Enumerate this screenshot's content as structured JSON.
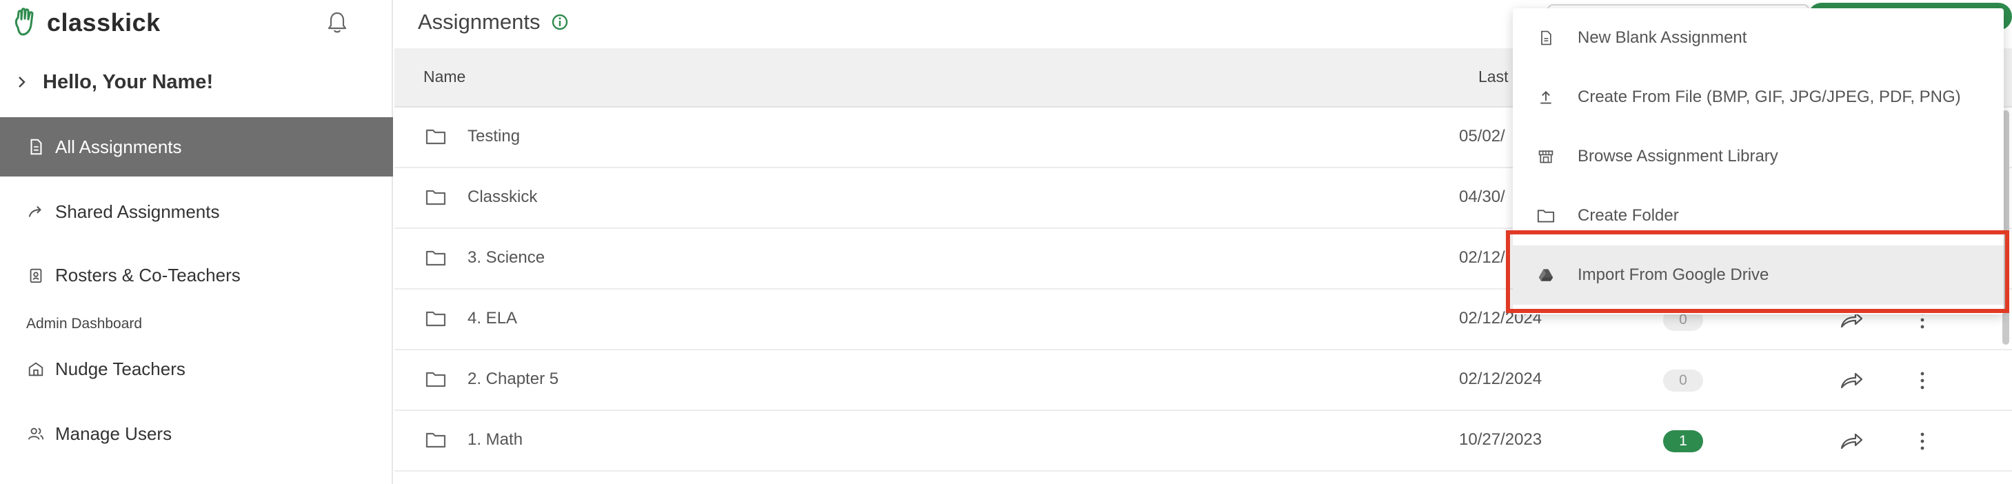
{
  "app": {
    "name": "classkick"
  },
  "sidebar": {
    "greeting": "Hello, Your Name!",
    "items": [
      {
        "label": "All Assignments",
        "icon": "document-icon",
        "active": true
      },
      {
        "label": "Shared Assignments",
        "icon": "share-arrow-icon",
        "active": false
      },
      {
        "label": "Rosters & Co-Teachers",
        "icon": "roster-badge-icon",
        "active": false
      }
    ],
    "admin_section_label": "Admin Dashboard",
    "admin_items": [
      {
        "label": "Nudge Teachers",
        "icon": "building-icon"
      },
      {
        "label": "Manage Users",
        "icon": "users-icon"
      }
    ]
  },
  "main": {
    "title": "Assignments",
    "columns": {
      "name": "Name",
      "last": "Last"
    },
    "rows": [
      {
        "name": "Testing",
        "date": "05/02/",
        "count": "",
        "show_actions": false
      },
      {
        "name": "Classkick",
        "date": "04/30/",
        "count": "",
        "show_actions": false
      },
      {
        "name": "3. Science",
        "date": "02/12/",
        "count": "",
        "show_actions": false
      },
      {
        "name": "4. ELA",
        "date": "02/12/2024",
        "count": "0",
        "show_actions": true
      },
      {
        "name": "2. Chapter 5",
        "date": "02/12/2024",
        "count": "0",
        "show_actions": true
      },
      {
        "name": "1. Math",
        "date": "10/27/2023",
        "count": "1",
        "show_actions": true,
        "count_highlight": true
      }
    ]
  },
  "menu": {
    "items": [
      {
        "label": "New Blank Assignment",
        "icon": "blank-document-icon"
      },
      {
        "label": "Create From File (BMP, GIF, JPG/JPEG, PDF, PNG)",
        "icon": "upload-icon"
      },
      {
        "label": "Browse Assignment Library",
        "icon": "library-store-icon"
      },
      {
        "label": "Create Folder",
        "icon": "folder-icon"
      },
      {
        "label": "Import From Google Drive",
        "icon": "google-drive-icon",
        "highlighted": true
      }
    ]
  },
  "colors": {
    "brand_green": "#2e8b4e",
    "active_nav": "#6f6f6f",
    "highlight_red": "#e03a25"
  }
}
